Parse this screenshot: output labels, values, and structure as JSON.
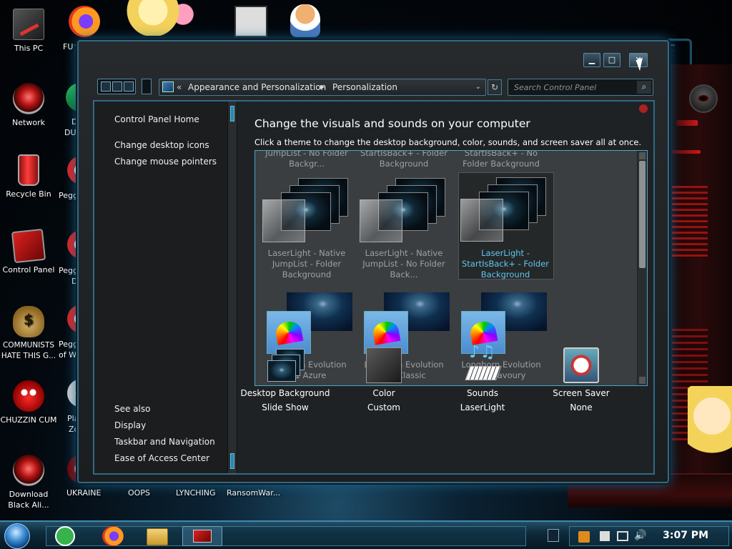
{
  "desktop": {
    "icons": [
      {
        "name": "this-pc",
        "label": "This PC"
      },
      {
        "name": "network",
        "label": "Network"
      },
      {
        "name": "recycle-bin",
        "label": "Recycle Bin"
      },
      {
        "name": "control-panel",
        "label": "Control Panel"
      },
      {
        "name": "communists",
        "label": "COMMUNISTS HATE THIS G..."
      },
      {
        "name": "chuzzin",
        "label": "CHUZZIN CUM"
      },
      {
        "name": "download",
        "label": "Download Black Ali..."
      }
    ],
    "partial_labels": {
      "fu": "FU",
      "d": "D",
      "du": "DU",
      "pegg1": "Pegg",
      "pegg2": "Pegg",
      "d2": "D",
      "pegg3": "Pegg",
      "ofw": "of W",
      "pla": "Pla",
      "zc": "Zc"
    },
    "bottom_labels": [
      "UKRAINE",
      "OOPS",
      "LYNCHING",
      "RansomWar..."
    ]
  },
  "window": {
    "caption_buttons": {
      "minimize": "▁",
      "maximize": "□",
      "close": "✕"
    },
    "address": {
      "chevron": "«",
      "segments": [
        "Appearance and Personalization",
        "Personalization"
      ],
      "separator": "▶",
      "dropdown": "⌄",
      "refresh": "↻"
    },
    "search": {
      "placeholder": "Search Control Panel",
      "button": "⌕"
    }
  },
  "sidebar": {
    "home": "Control Panel Home",
    "links": [
      "Change desktop icons",
      "Change mouse pointers"
    ],
    "see_also": "See also",
    "see_also_links": [
      "Display",
      "Taskbar and Navigation",
      "Ease of Access Center"
    ]
  },
  "main": {
    "title": "Change the visuals and sounds on your computer",
    "subtitle": "Click a theme to change the desktop background, color, sounds, and screen saver all at once.",
    "top_row_labels": [
      "JumpList - No Folder\nBackgr...",
      "StartIsBack+ - Folder\nBackground",
      "StartIsBack+ - No\nFolder Background"
    ],
    "themes_row1": [
      "LaserLight - Native\nJumpList - Folder\nBackground",
      "LaserLight - Native\nJumpList - No Folder\nBack...",
      "LaserLight -\nStartIsBack+ - Folder\nBackground"
    ],
    "themes_row2": [
      "Longhorn Evolution\n8.1 Azure",
      "Longhorn Evolution\n8.1 Classic",
      "Longhorn Evolution\n8.1 Savoury"
    ],
    "categories": [
      {
        "name": "desktop-background",
        "title": "Desktop Background",
        "value": "Slide Show"
      },
      {
        "name": "color",
        "title": "Color",
        "value": "Custom"
      },
      {
        "name": "sounds",
        "title": "Sounds",
        "value": "LaserLight"
      },
      {
        "name": "screen-saver",
        "title": "Screen Saver",
        "value": "None"
      }
    ]
  },
  "taskbar": {
    "time": "3:07 PM"
  },
  "colors": {
    "accent": "#2f6a86",
    "selected_text": "#5fc6f2",
    "theme_text": "#9ca0a3"
  }
}
